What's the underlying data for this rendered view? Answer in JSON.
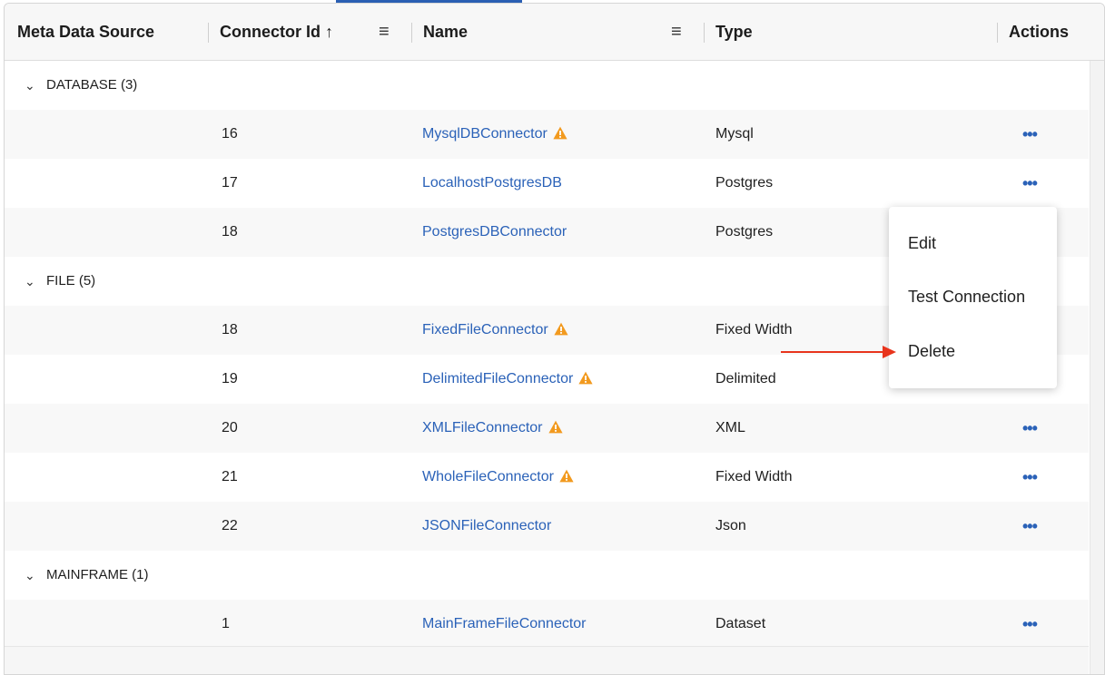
{
  "header": {
    "col_source": "Meta Data Source",
    "col_id": "Connector Id",
    "sort_arrow": "↑",
    "col_name": "Name",
    "col_type": "Type",
    "col_actions": "Actions",
    "menu_glyph": "≡"
  },
  "groups": [
    {
      "label": "DATABASE (3)"
    },
    {
      "label": "FILE (5)"
    },
    {
      "label": "MAINFRAME (1)"
    }
  ],
  "rows": [
    {
      "id": "16",
      "name": "MysqlDBConnector",
      "warning": true,
      "type": "Mysql"
    },
    {
      "id": "17",
      "name": "LocalhostPostgresDB",
      "warning": false,
      "type": "Postgres"
    },
    {
      "id": "18",
      "name": "PostgresDBConnector",
      "warning": false,
      "type": "Postgres"
    },
    {
      "id": "18",
      "name": "FixedFileConnector",
      "warning": true,
      "type": "Fixed Width"
    },
    {
      "id": "19",
      "name": "DelimitedFileConnector",
      "warning": true,
      "type": "Delimited"
    },
    {
      "id": "20",
      "name": "XMLFileConnector",
      "warning": true,
      "type": "XML"
    },
    {
      "id": "21",
      "name": "WholeFileConnector",
      "warning": true,
      "type": "Fixed Width"
    },
    {
      "id": "22",
      "name": "JSONFileConnector",
      "warning": false,
      "type": "Json"
    },
    {
      "id": "1",
      "name": "MainFrameFileConnector",
      "warning": false,
      "type": "Dataset"
    }
  ],
  "actions_glyph": "•••",
  "group_chevron": "⌄",
  "context_menu": {
    "items": [
      "Edit",
      "Test Connection",
      "Delete"
    ]
  },
  "colors": {
    "link": "#2b62b8",
    "warning": "#f29a1f",
    "annotation_arrow": "#e8341c"
  }
}
